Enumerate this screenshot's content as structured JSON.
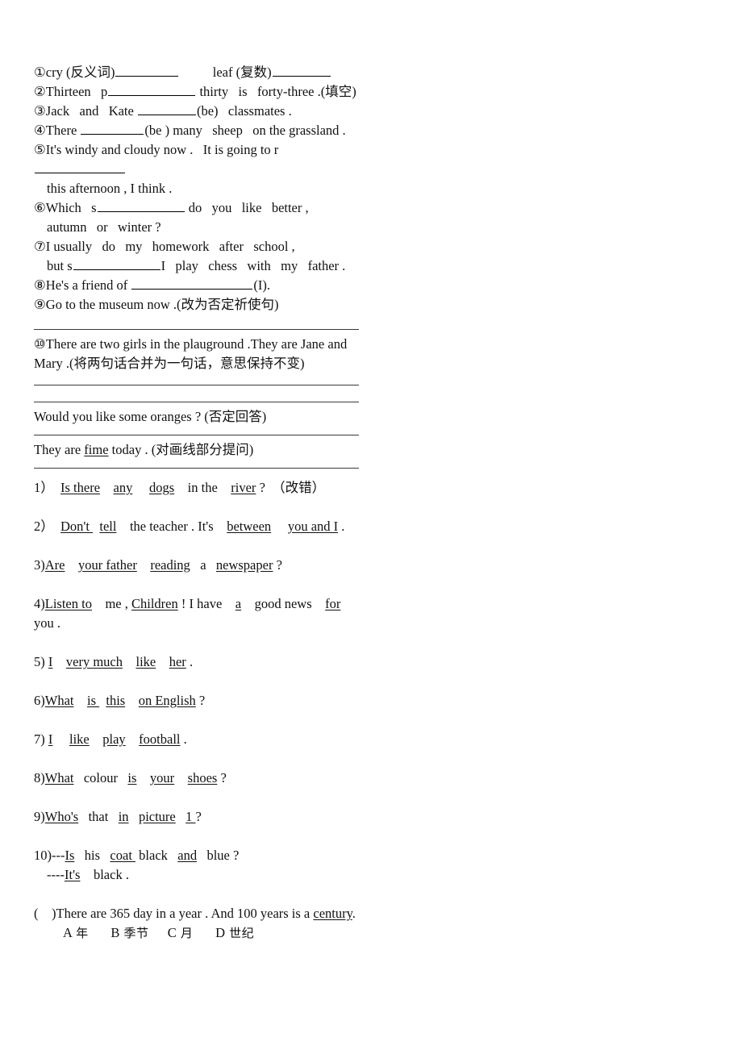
{
  "document": {
    "type": "english-worksheet",
    "fill_in_section": {
      "items": [
        {
          "marker": "①",
          "pre": "cry (反义词)",
          "mid": "          leaf (复数)",
          "post": "",
          "blanks": 2
        },
        {
          "marker": "②",
          "text_a": "Thirteen   p",
          "text_b": " thirty   is   forty-three .(填空)"
        },
        {
          "marker": "③",
          "text_a": "Jack   and   Kate ",
          "text_b": "(be)   classmates ."
        },
        {
          "marker": "④",
          "text_a": "There ",
          "text_b": "(be ) many   sheep   on the grassland ."
        },
        {
          "marker": "⑤",
          "text_a": "It's windy and cloudy now .   It is going to r",
          "text_b": "",
          "continuation": "this afternoon , I think ."
        },
        {
          "marker": "⑥",
          "text_a": "Which   s",
          "text_b": " do   you   like   better ,",
          "continuation": "autumn   or   winter ?"
        },
        {
          "marker": "⑦",
          "text_a": "I usually   do   my   homework   after   school ,",
          "continuation_a": "but s",
          "continuation_b": "I   play   chess   with   my   father ."
        },
        {
          "marker": "⑧",
          "text_a": "He's a friend of ",
          "text_b": "(I)."
        },
        {
          "marker": "⑨",
          "text_a": "Go to the museum now .(改为否定祈使句)"
        },
        {
          "marker": "⑩",
          "text_a": "There are two girls in the plauground .They are Jane and",
          "continuation": "Mary .(将两句话合并为一句话，意思保持不变)"
        }
      ]
    },
    "transform_section": {
      "q1": "Would you like some oranges ? (否定回答)",
      "q2_pre": "They are ",
      "q2_underlined": "fime",
      "q2_post": " today . (对画线部分提问)"
    },
    "error_correction": {
      "items": [
        {
          "number": "1）",
          "parts": [
            {
              "t": "  ",
              "u": false
            },
            {
              "t": "Is there",
              "u": true
            },
            {
              "t": "    ",
              "u": false
            },
            {
              "t": "any",
              "u": true
            },
            {
              "t": "     ",
              "u": false
            },
            {
              "t": "dogs",
              "u": true
            },
            {
              "t": "    in the    ",
              "u": false
            },
            {
              "t": "river",
              "u": true
            },
            {
              "t": " ?  （改错）",
              "u": false
            }
          ]
        },
        {
          "number": "2）",
          "parts": [
            {
              "t": "  ",
              "u": false
            },
            {
              "t": "Don't ",
              "u": true
            },
            {
              "t": "  ",
              "u": false
            },
            {
              "t": "tell",
              "u": true
            },
            {
              "t": "    the teacher . It's    ",
              "u": false
            },
            {
              "t": "between",
              "u": true
            },
            {
              "t": "     ",
              "u": false
            },
            {
              "t": "you and I",
              "u": true
            },
            {
              "t": " .",
              "u": false
            }
          ]
        },
        {
          "number": "3)",
          "parts": [
            {
              "t": "Are",
              "u": true
            },
            {
              "t": "    ",
              "u": false
            },
            {
              "t": "your father",
              "u": true
            },
            {
              "t": "    ",
              "u": false
            },
            {
              "t": "reading",
              "u": true
            },
            {
              "t": "   a   ",
              "u": false
            },
            {
              "t": "newspaper",
              "u": true
            },
            {
              "t": " ?",
              "u": false
            }
          ]
        },
        {
          "number": "4)",
          "parts": [
            {
              "t": "Listen to",
              "u": true
            },
            {
              "t": "    me , ",
              "u": false
            },
            {
              "t": "Children",
              "u": true
            },
            {
              "t": " ! I have    ",
              "u": false
            },
            {
              "t": "a",
              "u": true
            },
            {
              "t": "    good news    ",
              "u": false
            },
            {
              "t": "for",
              "u": true
            }
          ],
          "continuation": "you ."
        },
        {
          "number": "5)",
          "parts": [
            {
              "t": " ",
              "u": false
            },
            {
              "t": "I",
              "u": true
            },
            {
              "t": "    ",
              "u": false
            },
            {
              "t": "very much",
              "u": true
            },
            {
              "t": "    ",
              "u": false
            },
            {
              "t": "like",
              "u": true
            },
            {
              "t": "    ",
              "u": false
            },
            {
              "t": "her",
              "u": true
            },
            {
              "t": " .",
              "u": false
            }
          ]
        },
        {
          "number": "6)",
          "parts": [
            {
              "t": "What",
              "u": true
            },
            {
              "t": "    ",
              "u": false
            },
            {
              "t": "is ",
              "u": true
            },
            {
              "t": "  ",
              "u": false
            },
            {
              "t": "this",
              "u": true
            },
            {
              "t": "    ",
              "u": false
            },
            {
              "t": "on English",
              "u": true
            },
            {
              "t": " ?",
              "u": false
            }
          ]
        },
        {
          "number": "7)",
          "parts": [
            {
              "t": " ",
              "u": false
            },
            {
              "t": "I",
              "u": true
            },
            {
              "t": "     ",
              "u": false
            },
            {
              "t": "like",
              "u": true
            },
            {
              "t": "    ",
              "u": false
            },
            {
              "t": "play",
              "u": true
            },
            {
              "t": "    ",
              "u": false
            },
            {
              "t": "football",
              "u": true
            },
            {
              "t": " .",
              "u": false
            }
          ]
        },
        {
          "number": "8)",
          "parts": [
            {
              "t": "What",
              "u": true
            },
            {
              "t": "   colour   ",
              "u": false
            },
            {
              "t": "is",
              "u": true
            },
            {
              "t": "    ",
              "u": false
            },
            {
              "t": "your",
              "u": true
            },
            {
              "t": "    ",
              "u": false
            },
            {
              "t": "shoes",
              "u": true
            },
            {
              "t": " ?",
              "u": false
            }
          ]
        },
        {
          "number": "9)",
          "parts": [
            {
              "t": "Who's",
              "u": true
            },
            {
              "t": "   that   ",
              "u": false
            },
            {
              "t": "in",
              "u": true
            },
            {
              "t": "   ",
              "u": false
            },
            {
              "t": "picture",
              "u": true
            },
            {
              "t": "   ",
              "u": false
            },
            {
              "t": "1 ",
              "u": true
            },
            {
              "t": "?",
              "u": false
            }
          ]
        },
        {
          "number": "10)",
          "parts": [
            {
              "t": "---",
              "u": false
            },
            {
              "t": "Is",
              "u": true
            },
            {
              "t": "   his   ",
              "u": false
            },
            {
              "t": "coat ",
              "u": true
            },
            {
              "t": " black   ",
              "u": false
            },
            {
              "t": "and",
              "u": true
            },
            {
              "t": "   blue ?",
              "u": false
            }
          ],
          "continuation_parts": [
            {
              "t": "----",
              "u": false
            },
            {
              "t": "It's",
              "u": true
            },
            {
              "t": "    black .",
              "u": false
            }
          ]
        }
      ]
    },
    "multiple_choice": {
      "bracket": "(    )",
      "stem_pre": "There are 365 day in a year . And 100 years is a ",
      "stem_underlined": "century",
      "stem_post": ".",
      "options": [
        {
          "letter": "A",
          "text": "年"
        },
        {
          "letter": "B",
          "text": "季节"
        },
        {
          "letter": "C",
          "text": "月"
        },
        {
          "letter": "D",
          "text": "世纪"
        }
      ]
    }
  }
}
